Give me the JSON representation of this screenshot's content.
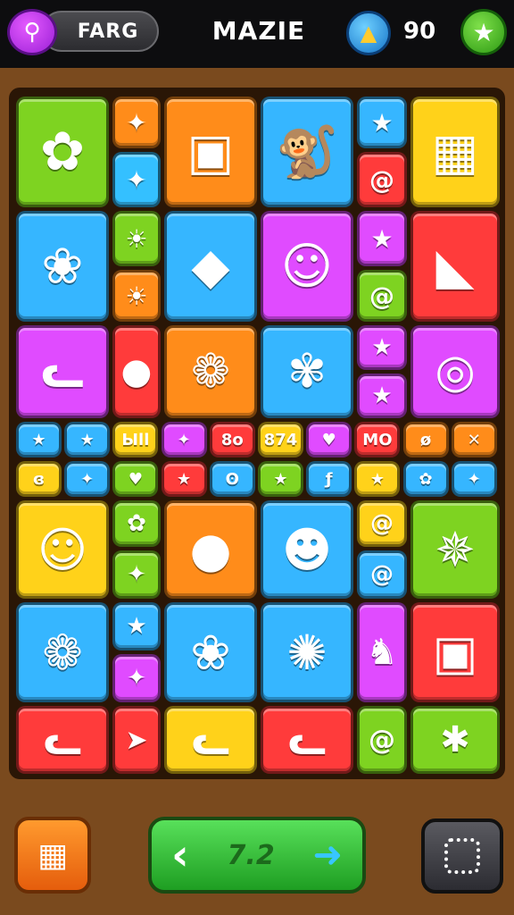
{
  "header": {
    "menu_icon": "magnifier-icon",
    "pill_label": "FARG",
    "title": "MAZIE",
    "coin_icon": "rocket-coin-icon",
    "score": "90",
    "star_icon": "star-icon"
  },
  "tiles": [
    {
      "icon": "flower-icon",
      "color": "#7ed321"
    },
    {
      "icon": "sparkle-icon",
      "color": "#ff8c1a"
    },
    {
      "icon": "sparkle-icon",
      "color": "#34c0ff"
    },
    {
      "icon": "battery-icon",
      "color": "#ff8c1a"
    },
    {
      "icon": "monkey-icon",
      "color": "#36b6ff"
    },
    {
      "icon": "star-icon",
      "color": "#36b6ff"
    },
    {
      "icon": "swirl-icon",
      "color": "#ff3b3b"
    },
    {
      "icon": "crate-icon",
      "color": "#ffd21a"
    },
    {
      "icon": "rose-icon",
      "color": "#36b6ff"
    },
    {
      "icon": "sun-icon",
      "color": "#7ed321"
    },
    {
      "icon": "sun-icon",
      "color": "#ff8c1a"
    },
    {
      "icon": "kite-icon",
      "color": "#36b6ff"
    },
    {
      "icon": "princess-icon",
      "color": "#e04bff"
    },
    {
      "icon": "star-icon",
      "color": "#e04bff"
    },
    {
      "icon": "swirl-icon",
      "color": "#7ed321"
    },
    {
      "icon": "bird-icon",
      "color": "#ff3b3b"
    },
    {
      "icon": "cat-icon",
      "color": "#e04bff"
    },
    {
      "icon": "balloon-icon",
      "color": "#ff3b3b"
    },
    {
      "icon": "sunflower-icon",
      "color": "#ff8c1a"
    },
    {
      "icon": "blue-flower-icon",
      "color": "#36b6ff"
    },
    {
      "icon": "star-icon",
      "color": "#e04bff"
    },
    {
      "icon": "star-icon",
      "color": "#e04bff"
    },
    {
      "icon": "donut-icon",
      "color": "#e04bff"
    }
  ],
  "small_row1": [
    {
      "label": "★",
      "color": "#36b6ff"
    },
    {
      "label": "★",
      "color": "#36b6ff"
    },
    {
      "label": "Ыll",
      "color": "#ffd21a"
    },
    {
      "label": "✦",
      "color": "#e04bff"
    },
    {
      "label": "8o",
      "color": "#ff3b3b"
    },
    {
      "label": "874",
      "color": "#ffd21a"
    },
    {
      "label": "♥",
      "color": "#e04bff"
    },
    {
      "label": "MO",
      "color": "#ff3b3b"
    },
    {
      "label": "ø",
      "color": "#ff8c1a"
    },
    {
      "label": "✕",
      "color": "#ff8c1a"
    }
  ],
  "small_row2": [
    {
      "label": "ɞ",
      "color": "#ffd21a"
    },
    {
      "label": "✦",
      "color": "#36b6ff"
    },
    {
      "label": "♥",
      "color": "#7ed321"
    },
    {
      "label": "★",
      "color": "#ff3b3b"
    },
    {
      "label": "ʘ",
      "color": "#36b6ff"
    },
    {
      "label": "★",
      "color": "#7ed321"
    },
    {
      "label": "ƒ",
      "color": "#36b6ff"
    },
    {
      "label": "★",
      "color": "#ffd21a"
    },
    {
      "label": "✿",
      "color": "#36b6ff"
    },
    {
      "label": "✦",
      "color": "#36b6ff"
    }
  ],
  "lower_tiles": [
    {
      "icon": "chick-icon",
      "color": "#ffd21a"
    },
    {
      "icon": "flower-icon",
      "color": "#7ed321"
    },
    {
      "icon": "sparkle-icon",
      "color": "#7ed321"
    },
    {
      "icon": "cherry-icon",
      "color": "#ff8c1a"
    },
    {
      "icon": "blob-icon",
      "color": "#36b6ff"
    },
    {
      "icon": "swirl-icon",
      "color": "#ffd21a"
    },
    {
      "icon": "swirl-icon",
      "color": "#36b6ff"
    },
    {
      "icon": "leaf-flower-icon",
      "color": "#7ed321"
    },
    {
      "icon": "sunflower-icon",
      "color": "#36b6ff"
    },
    {
      "icon": "star-icon",
      "color": "#36b6ff"
    },
    {
      "icon": "sparkle-icon",
      "color": "#e04bff"
    },
    {
      "icon": "rose-icon",
      "color": "#36b6ff"
    },
    {
      "icon": "pink-flower-icon",
      "color": "#36b6ff"
    },
    {
      "icon": "genie-icon",
      "color": "#e04bff"
    },
    {
      "icon": "picture-icon",
      "color": "#ff3b3b"
    },
    {
      "icon": "cat-icon",
      "color": "#ff3b3b"
    },
    {
      "icon": "arrow-icon",
      "color": "#ff3b3b"
    },
    {
      "icon": "cat-icon",
      "color": "#ffd21a"
    },
    {
      "icon": "cat-icon",
      "color": "#ff3b3b"
    },
    {
      "icon": "swirl-icon",
      "color": "#7ed321"
    },
    {
      "icon": "bug-icon",
      "color": "#7ed321"
    }
  ],
  "footer": {
    "left_icon": "grid-icon",
    "nav_text": "7.2",
    "left_arrow": "‹",
    "right_arrow": "➜",
    "right_icon": "dotted-square-icon"
  }
}
